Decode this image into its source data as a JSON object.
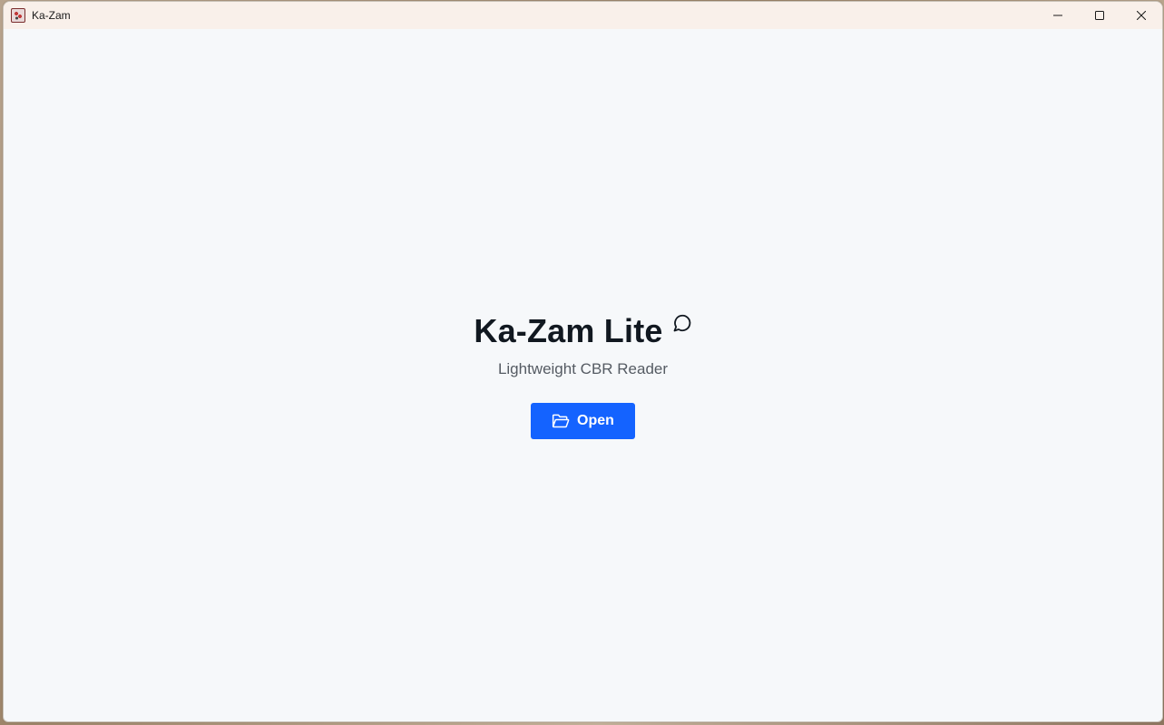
{
  "window": {
    "title": "Ka-Zam",
    "app_icon": "ka-zam-app-icon",
    "controls": [
      "minimize-icon",
      "maximize-icon",
      "close-icon"
    ]
  },
  "main": {
    "heading": "Ka-Zam Lite",
    "heading_icon": "chat-bubble-icon",
    "subtitle": "Lightweight CBR Reader",
    "open_button": {
      "label": "Open",
      "icon": "folder-open-icon"
    }
  },
  "colors": {
    "accent": "#1463ff",
    "background": "#f6f8fa",
    "titlebar": "#f9f0ea",
    "heading": "#111820",
    "subtitle": "#555b63"
  }
}
